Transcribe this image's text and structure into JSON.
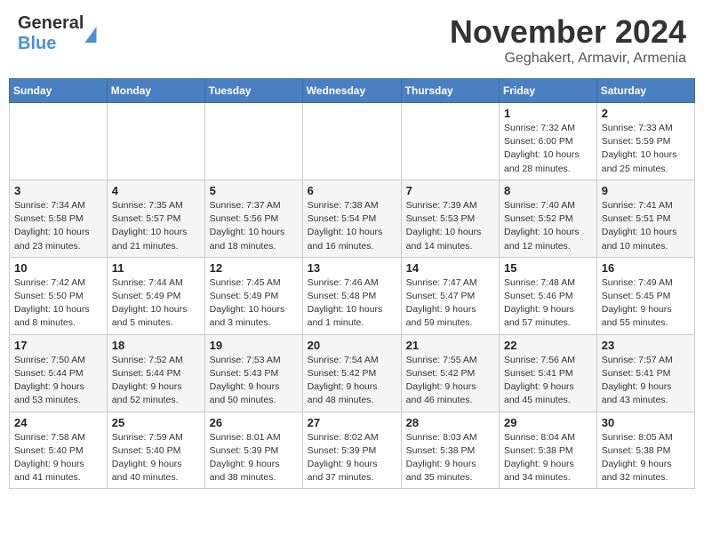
{
  "header": {
    "logo_line1": "General",
    "logo_line2": "Blue",
    "month_title": "November 2024",
    "location": "Geghakert, Armavir, Armenia"
  },
  "calendar": {
    "days_of_week": [
      "Sunday",
      "Monday",
      "Tuesday",
      "Wednesday",
      "Thursday",
      "Friday",
      "Saturday"
    ],
    "weeks": [
      [
        {
          "day": "",
          "info": ""
        },
        {
          "day": "",
          "info": ""
        },
        {
          "day": "",
          "info": ""
        },
        {
          "day": "",
          "info": ""
        },
        {
          "day": "",
          "info": ""
        },
        {
          "day": "1",
          "info": "Sunrise: 7:32 AM\nSunset: 6:00 PM\nDaylight: 10 hours\nand 28 minutes."
        },
        {
          "day": "2",
          "info": "Sunrise: 7:33 AM\nSunset: 5:59 PM\nDaylight: 10 hours\nand 25 minutes."
        }
      ],
      [
        {
          "day": "3",
          "info": "Sunrise: 7:34 AM\nSunset: 5:58 PM\nDaylight: 10 hours\nand 23 minutes."
        },
        {
          "day": "4",
          "info": "Sunrise: 7:35 AM\nSunset: 5:57 PM\nDaylight: 10 hours\nand 21 minutes."
        },
        {
          "day": "5",
          "info": "Sunrise: 7:37 AM\nSunset: 5:56 PM\nDaylight: 10 hours\nand 18 minutes."
        },
        {
          "day": "6",
          "info": "Sunrise: 7:38 AM\nSunset: 5:54 PM\nDaylight: 10 hours\nand 16 minutes."
        },
        {
          "day": "7",
          "info": "Sunrise: 7:39 AM\nSunset: 5:53 PM\nDaylight: 10 hours\nand 14 minutes."
        },
        {
          "day": "8",
          "info": "Sunrise: 7:40 AM\nSunset: 5:52 PM\nDaylight: 10 hours\nand 12 minutes."
        },
        {
          "day": "9",
          "info": "Sunrise: 7:41 AM\nSunset: 5:51 PM\nDaylight: 10 hours\nand 10 minutes."
        }
      ],
      [
        {
          "day": "10",
          "info": "Sunrise: 7:42 AM\nSunset: 5:50 PM\nDaylight: 10 hours\nand 8 minutes."
        },
        {
          "day": "11",
          "info": "Sunrise: 7:44 AM\nSunset: 5:49 PM\nDaylight: 10 hours\nand 5 minutes."
        },
        {
          "day": "12",
          "info": "Sunrise: 7:45 AM\nSunset: 5:49 PM\nDaylight: 10 hours\nand 3 minutes."
        },
        {
          "day": "13",
          "info": "Sunrise: 7:46 AM\nSunset: 5:48 PM\nDaylight: 10 hours\nand 1 minute."
        },
        {
          "day": "14",
          "info": "Sunrise: 7:47 AM\nSunset: 5:47 PM\nDaylight: 9 hours\nand 59 minutes."
        },
        {
          "day": "15",
          "info": "Sunrise: 7:48 AM\nSunset: 5:46 PM\nDaylight: 9 hours\nand 57 minutes."
        },
        {
          "day": "16",
          "info": "Sunrise: 7:49 AM\nSunset: 5:45 PM\nDaylight: 9 hours\nand 55 minutes."
        }
      ],
      [
        {
          "day": "17",
          "info": "Sunrise: 7:50 AM\nSunset: 5:44 PM\nDaylight: 9 hours\nand 53 minutes."
        },
        {
          "day": "18",
          "info": "Sunrise: 7:52 AM\nSunset: 5:44 PM\nDaylight: 9 hours\nand 52 minutes."
        },
        {
          "day": "19",
          "info": "Sunrise: 7:53 AM\nSunset: 5:43 PM\nDaylight: 9 hours\nand 50 minutes."
        },
        {
          "day": "20",
          "info": "Sunrise: 7:54 AM\nSunset: 5:42 PM\nDaylight: 9 hours\nand 48 minutes."
        },
        {
          "day": "21",
          "info": "Sunrise: 7:55 AM\nSunset: 5:42 PM\nDaylight: 9 hours\nand 46 minutes."
        },
        {
          "day": "22",
          "info": "Sunrise: 7:56 AM\nSunset: 5:41 PM\nDaylight: 9 hours\nand 45 minutes."
        },
        {
          "day": "23",
          "info": "Sunrise: 7:57 AM\nSunset: 5:41 PM\nDaylight: 9 hours\nand 43 minutes."
        }
      ],
      [
        {
          "day": "24",
          "info": "Sunrise: 7:58 AM\nSunset: 5:40 PM\nDaylight: 9 hours\nand 41 minutes."
        },
        {
          "day": "25",
          "info": "Sunrise: 7:59 AM\nSunset: 5:40 PM\nDaylight: 9 hours\nand 40 minutes."
        },
        {
          "day": "26",
          "info": "Sunrise: 8:01 AM\nSunset: 5:39 PM\nDaylight: 9 hours\nand 38 minutes."
        },
        {
          "day": "27",
          "info": "Sunrise: 8:02 AM\nSunset: 5:39 PM\nDaylight: 9 hours\nand 37 minutes."
        },
        {
          "day": "28",
          "info": "Sunrise: 8:03 AM\nSunset: 5:38 PM\nDaylight: 9 hours\nand 35 minutes."
        },
        {
          "day": "29",
          "info": "Sunrise: 8:04 AM\nSunset: 5:38 PM\nDaylight: 9 hours\nand 34 minutes."
        },
        {
          "day": "30",
          "info": "Sunrise: 8:05 AM\nSunset: 5:38 PM\nDaylight: 9 hours\nand 32 minutes."
        }
      ]
    ]
  }
}
